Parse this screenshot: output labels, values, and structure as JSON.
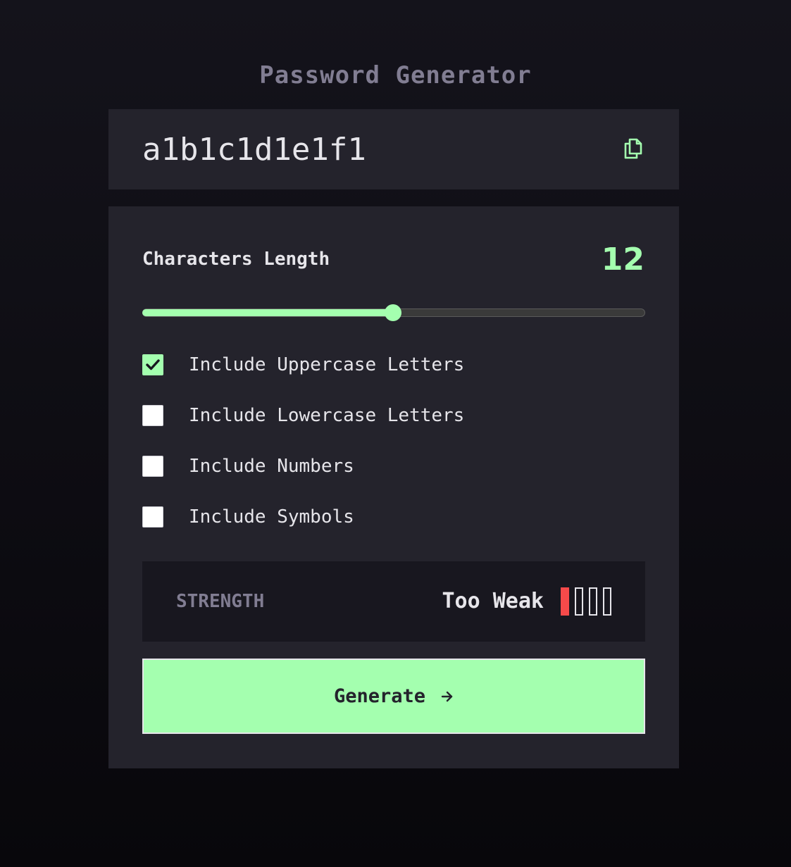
{
  "app": {
    "title": "Password Generator"
  },
  "password": {
    "value": "a1b1c1d1e1f1",
    "copy_icon": "copy-icon"
  },
  "length": {
    "label": "Characters Length",
    "value": "12",
    "slider_fraction": 0.5
  },
  "options": [
    {
      "label": "Include Uppercase Letters",
      "checked": true
    },
    {
      "label": "Include Lowercase Letters",
      "checked": false
    },
    {
      "label": "Include Numbers",
      "checked": false
    },
    {
      "label": "Include Symbols",
      "checked": false
    }
  ],
  "strength": {
    "label": "STRENGTH",
    "value": "Too Weak",
    "level": 1,
    "max_level": 4
  },
  "generate": {
    "label": "Generate",
    "icon": "arrow-right-icon"
  },
  "colors": {
    "accent": "#a4ffaf",
    "too_weak": "#f64a4a",
    "panel": "#24232c",
    "text": "#e6e5ea",
    "muted": "#817d92"
  }
}
